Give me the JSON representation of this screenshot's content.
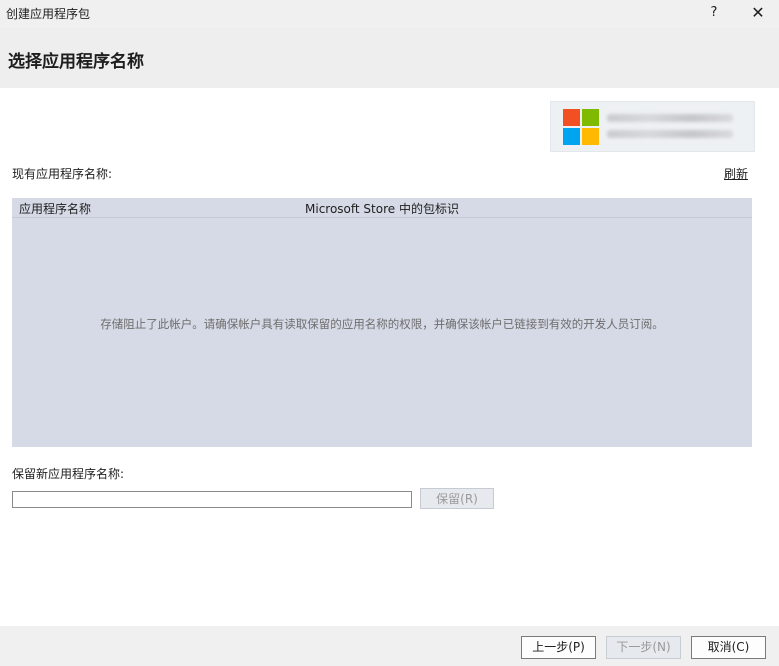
{
  "window": {
    "title": "创建应用程序包",
    "help_label": "?",
    "close_label": "✕"
  },
  "header": {
    "page_title": "选择应用程序名称"
  },
  "brand": {
    "colors": [
      "#f25022",
      "#7fba00",
      "#00a4ef",
      "#ffb900"
    ]
  },
  "existing": {
    "label": "现有应用程序名称:",
    "refresh_label": "刷新",
    "columns": [
      "应用程序名称",
      "Microsoft Store 中的包标识"
    ],
    "empty_message": "存储阻止了此帐户。请确保帐户具有读取保留的应用名称的权限，并确保该帐户已链接到有效的开发人员订阅。"
  },
  "reserve": {
    "label": "保留新应用程序名称:",
    "input_value": "",
    "button_label": "保留(R)"
  },
  "footer": {
    "prev_label": "上一步(P)",
    "next_label": "下一步(N)",
    "cancel_label": "取消(C)"
  }
}
